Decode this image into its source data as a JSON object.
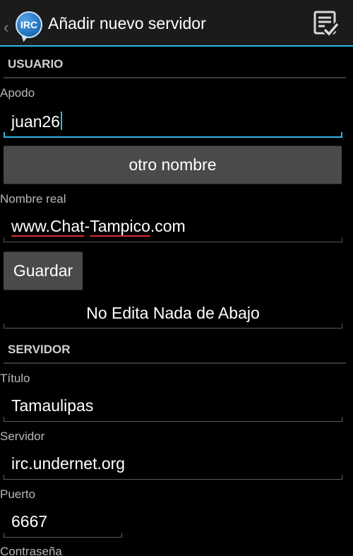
{
  "actionbar": {
    "title": "Añadir nuevo servidor",
    "app_icon_text": "IRC",
    "up_caret": "‹",
    "icons": {
      "app": "irc-app-icon",
      "save": "save-checklist-icon",
      "up": "chevron-left-icon"
    }
  },
  "sections": {
    "usuario": "USUARIO",
    "servidor": "SERVIDOR"
  },
  "usuario": {
    "apodo_label": "Apodo",
    "apodo_value": "juan26",
    "otro_nombre_button": "otro nombre",
    "nombre_real_label": "Nombre real",
    "nombre_real_value_part1": "www.Chat",
    "nombre_real_value_sep": "-",
    "nombre_real_value_part2": "Tampico",
    "nombre_real_value_part3": ".com",
    "guardar_button": "Guardar",
    "note": "No Edita Nada de Abajo"
  },
  "servidor": {
    "titulo_label": "Título",
    "titulo_value": "Tamaulipas",
    "servidor_label": "Servidor",
    "servidor_value": "irc.undernet.org",
    "puerto_label": "Puerto",
    "puerto_value": "6667",
    "contrasena_label": "Contraseña"
  },
  "colors": {
    "accent": "#33b5e5",
    "background": "#000000",
    "actionbar": "#1b1b1b",
    "button": "#4a4a4a",
    "spellcheck": "#d32f2f"
  }
}
